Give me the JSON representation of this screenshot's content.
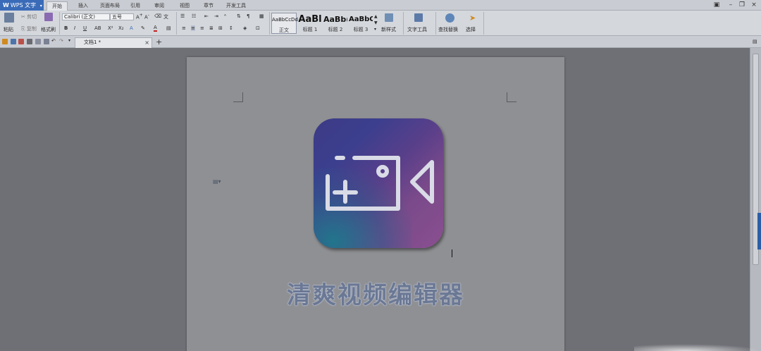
{
  "app": {
    "name": "WPS 文字"
  },
  "menu_tabs": [
    "开始",
    "插入",
    "页面布局",
    "引用",
    "审阅",
    "视图",
    "章节",
    "开发工具"
  ],
  "clipboard": {
    "paste": "粘贴",
    "cut": "剪切",
    "copy": "复制",
    "format_painter": "格式刷"
  },
  "font": {
    "name": "Calibri (正文)",
    "size": "五号"
  },
  "styles": [
    {
      "sample": "AaBbCcDd",
      "label": "正文"
    },
    {
      "sample": "AaBl",
      "label": "标题 1"
    },
    {
      "sample": "AaBb(",
      "label": "标题 2"
    },
    {
      "sample": "AaBbC",
      "label": "标题 3"
    }
  ],
  "tools": {
    "new_style": "新样式",
    "text_tools": "文字工具",
    "find_replace": "查找替换",
    "select": "选择"
  },
  "document": {
    "tab_title": "文档1 *",
    "heading": "清爽视频编辑器"
  },
  "colors": {
    "accent": "#3a6bb8",
    "logo_start": "#3d3a86",
    "logo_end": "#8a4f8f",
    "heading": "#6b7894"
  }
}
